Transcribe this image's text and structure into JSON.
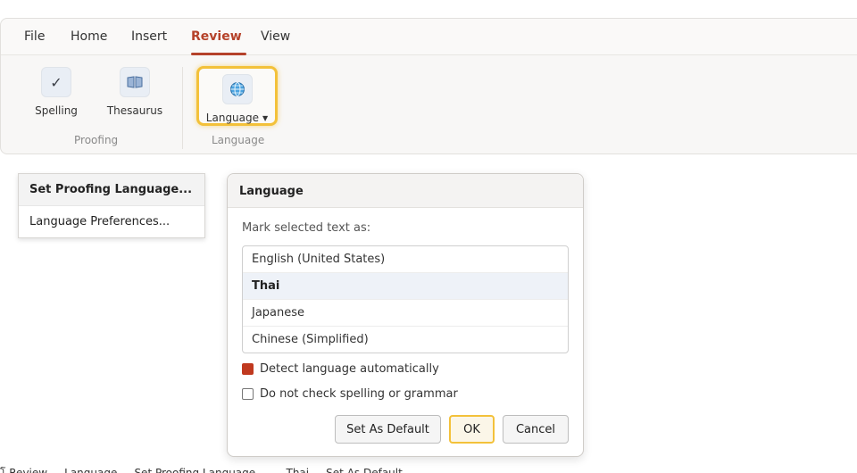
{
  "ribbon": {
    "tabs": [
      {
        "label": "File"
      },
      {
        "label": "Home"
      },
      {
        "label": "Insert"
      },
      {
        "label": "Review",
        "active": true
      },
      {
        "label": "View"
      }
    ],
    "groups": {
      "proofing": {
        "label": "Proofing",
        "spelling": {
          "label": "Spelling",
          "icon": "check-icon"
        },
        "thesaurus": {
          "label": "Thesaurus",
          "icon": "book-icon"
        }
      },
      "language": {
        "label": "Language",
        "button": {
          "label": "Language",
          "icon": "globe-icon"
        }
      }
    },
    "accent_color": "#b5422a",
    "highlight_color": "#f3c13a"
  },
  "language_menu": {
    "items": [
      {
        "label": "Set Proofing Language..."
      },
      {
        "label": "Language Preferences..."
      }
    ]
  },
  "dialog": {
    "title": "Language",
    "prompt": "Mark selected text as:",
    "languages": [
      {
        "label": "English (United States)"
      },
      {
        "label": "Thai",
        "selected": true
      },
      {
        "label": "Japanese"
      },
      {
        "label": "Chinese (Simplified)"
      }
    ],
    "detect_auto": {
      "label": "Detect language automatically",
      "checked": true
    },
    "no_check": {
      "label": "Do not check spelling or grammar",
      "checked": false
    },
    "buttons": {
      "set_default": "Set As Default",
      "ok": "OK",
      "cancel": "Cancel"
    }
  },
  "document": {
    "bottom_line": "โ  Review ...  Language ...  Set Proofing Language ...  ...  Thai  ...  Set As Default ..."
  }
}
